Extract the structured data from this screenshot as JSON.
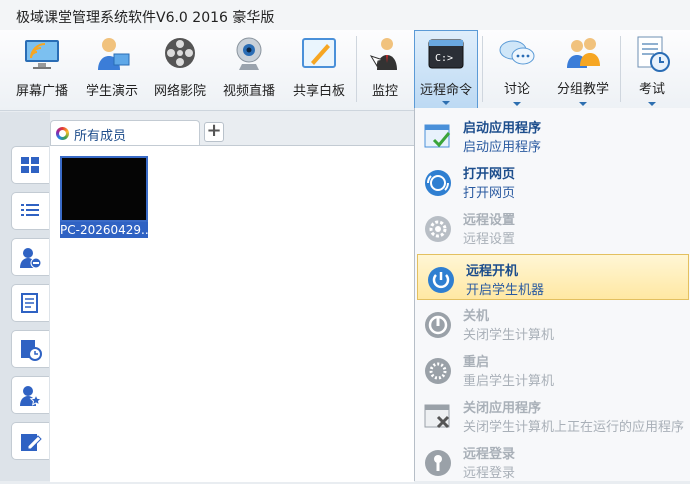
{
  "window": {
    "title": "极域课堂管理系统软件V6.0 2016 豪华版"
  },
  "toolbar": {
    "items": [
      {
        "label": "屏幕广播",
        "icon": "screen-broadcast-icon"
      },
      {
        "label": "学生演示",
        "icon": "student-demo-icon"
      },
      {
        "label": "网络影院",
        "icon": "film-reel-icon"
      },
      {
        "label": "视频直播",
        "icon": "webcam-icon"
      },
      {
        "label": "共享白板",
        "icon": "whiteboard-icon"
      },
      {
        "label": "监控",
        "icon": "monitor-person-icon"
      },
      {
        "label": "远程命令",
        "icon": "command-prompt-icon"
      },
      {
        "label": "讨论",
        "icon": "chat-bubbles-icon"
      },
      {
        "label": "分组教学",
        "icon": "group-users-icon"
      },
      {
        "label": "考试",
        "icon": "exam-clock-icon"
      }
    ]
  },
  "tabs": {
    "active_label": "所有成员",
    "add_label": "+"
  },
  "student": {
    "name": "PC-20260429..."
  },
  "menu": {
    "items": [
      {
        "title": "启动应用程序",
        "desc": "启动应用程序",
        "enabled": true
      },
      {
        "title": "打开网页",
        "desc": "打开网页",
        "enabled": true
      },
      {
        "title": "远程设置",
        "desc": "远程设置",
        "enabled": false
      },
      {
        "title": "远程开机",
        "desc": "开启学生机器",
        "enabled": true,
        "highlighted": true
      },
      {
        "title": "关机",
        "desc": "关闭学生计算机",
        "enabled": false
      },
      {
        "title": "重启",
        "desc": "重启学生计算机",
        "enabled": false
      },
      {
        "title": "关闭应用程序",
        "desc": "关闭学生计算机上正在运行的应用程序",
        "enabled": false
      },
      {
        "title": "远程登录",
        "desc": "远程登录",
        "enabled": false
      }
    ]
  },
  "colors": {
    "accent": "#2f62c3",
    "menu_highlight": "#ffe8a3"
  }
}
